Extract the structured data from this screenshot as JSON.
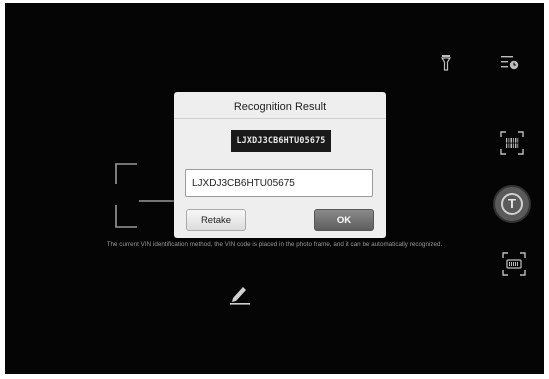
{
  "toolbar": {
    "icons": [
      "flashlight-icon",
      "history-icon",
      "barcode-scan-icon",
      "shutter-icon",
      "vin-scan-icon",
      "edit-icon"
    ],
    "shutter_label": "T"
  },
  "camera": {
    "hint": "The current VIN identification method, the VIN code is placed in the photo frame, and it can be automatically recognized."
  },
  "dialog": {
    "title": "Recognition Result",
    "vin_image_text": "LJXDJ3CB6HTU05675",
    "vin_value": "LJXDJ3CB6HTU05675",
    "retake_label": "Retake",
    "ok_label": "OK"
  }
}
